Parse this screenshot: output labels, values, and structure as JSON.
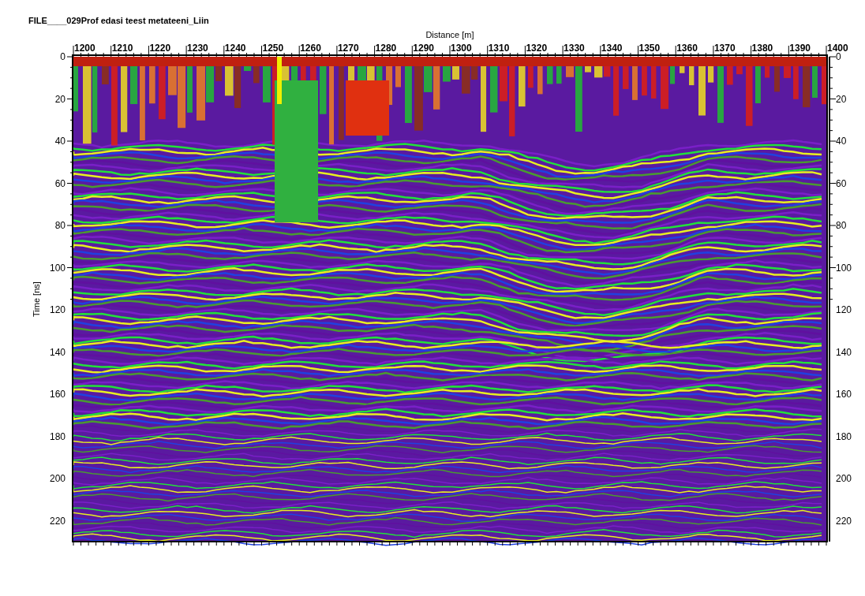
{
  "title": "FILE____029Prof edasi teest metateeni_Liin",
  "x_axis": {
    "label": "Distance [m]",
    "ticks": [
      "1200",
      "1210",
      "1220",
      "1230",
      "1240",
      "1250",
      "1260",
      "1270",
      "1280",
      "1290",
      "1300",
      "1310",
      "1320",
      "1330",
      "1340",
      "1350",
      "1360",
      "1370",
      "1380",
      "1390",
      "1400"
    ]
  },
  "y_axis": {
    "label": "Time [ns]",
    "ticks": [
      "0",
      "20",
      "40",
      "60",
      "80",
      "100",
      "120",
      "140",
      "160",
      "180",
      "200",
      "220"
    ]
  },
  "y_axis_right": {
    "ticks": [
      "0",
      "20",
      "40",
      "60",
      "80",
      "100",
      "120",
      "140",
      "160",
      "180",
      "200",
      "220"
    ]
  }
}
